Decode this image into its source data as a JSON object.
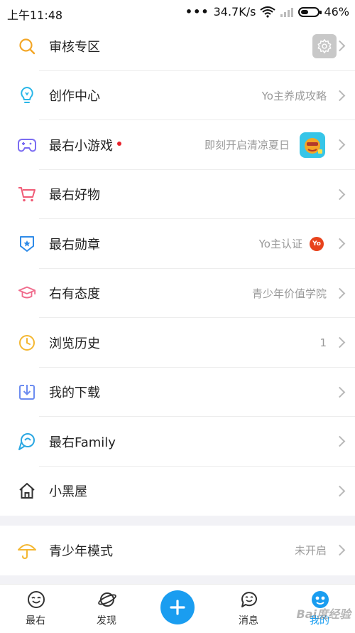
{
  "status_bar": {
    "time": "上午11:48",
    "network_speed": "34.7K/s",
    "battery": "46%",
    "battery_level": 0.46
  },
  "menu": [
    {
      "label": "审核专区",
      "icon": "search-icon",
      "color": "#f3a626"
    },
    {
      "label": "创作中心",
      "sub": "Yo主养成攻略",
      "icon": "lightbulb-icon",
      "color": "#29b6e8"
    },
    {
      "label": "最右小游戏",
      "sub": "即刻开启清凉夏日",
      "icon": "gamepad-icon",
      "color": "#7b6cf2",
      "new_dot": true
    },
    {
      "label": "最右好物",
      "icon": "shopping-cart-icon",
      "color": "#f05b76"
    },
    {
      "label": "最右勋章",
      "sub": "Yo主认证",
      "badge": "Yo",
      "icon": "medal-icon",
      "color": "#2f8be8"
    },
    {
      "label": "右有态度",
      "sub": "青少年价值学院",
      "icon": "graduation-cap-icon",
      "color": "#f06b8c"
    },
    {
      "label": "浏览历史",
      "sub": "1",
      "icon": "clock-icon",
      "color": "#f4b731"
    },
    {
      "label": "我的下载",
      "icon": "download-icon",
      "color": "#6c8cf0"
    },
    {
      "label": "最右Family",
      "icon": "family-icon",
      "color": "#2aa7e2"
    },
    {
      "label": "小黑屋",
      "icon": "house-icon",
      "color": "#333333"
    }
  ],
  "youth_mode": {
    "label": "青少年模式",
    "status": "未开启",
    "icon": "umbrella-icon",
    "color": "#f4b731"
  },
  "tabbar": {
    "tabs": [
      {
        "label": "最右",
        "icon": "smiley-icon"
      },
      {
        "label": "发现",
        "icon": "planet-icon"
      },
      {
        "label": "消息",
        "icon": "message-icon"
      },
      {
        "label": "我的",
        "icon": "avatar-icon",
        "active": true
      }
    ],
    "accent": "#1a9df0"
  },
  "watermark": "Bai度经验"
}
